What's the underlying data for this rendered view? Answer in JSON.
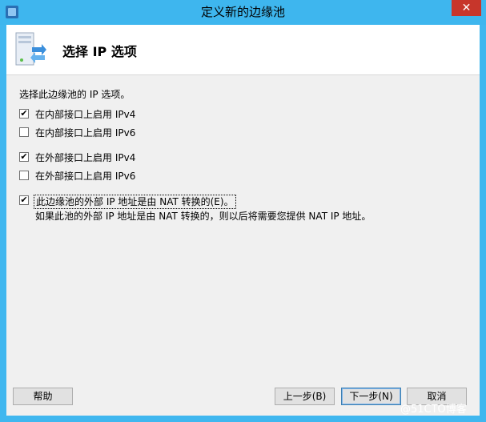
{
  "window": {
    "title": "定义新的边缘池",
    "close_glyph": "✕"
  },
  "header": {
    "title": "选择 IP 选项"
  },
  "main": {
    "prompt": "选择此边缘池的 IP 选项。",
    "options": [
      {
        "label": "在内部接口上启用 IPv4",
        "checked": true
      },
      {
        "label": "在内部接口上启用 IPv6",
        "checked": false
      },
      {
        "label": "在外部接口上启用 IPv4",
        "checked": true
      },
      {
        "label": "在外部接口上启用 IPv6",
        "checked": false
      },
      {
        "label": "此边缘池的外部 IP 地址是由 NAT 转换的(E)。",
        "checked": true
      }
    ],
    "nat_note": "如果此池的外部 IP 地址是由 NAT 转换的，则以后将需要您提供 NAT IP 地址。",
    "check_glyph": "✔"
  },
  "buttons": {
    "help": "帮助",
    "back": "上一步(B)",
    "next": "下一步(N)",
    "cancel": "取消"
  },
  "watermark": "@51CTO博客"
}
